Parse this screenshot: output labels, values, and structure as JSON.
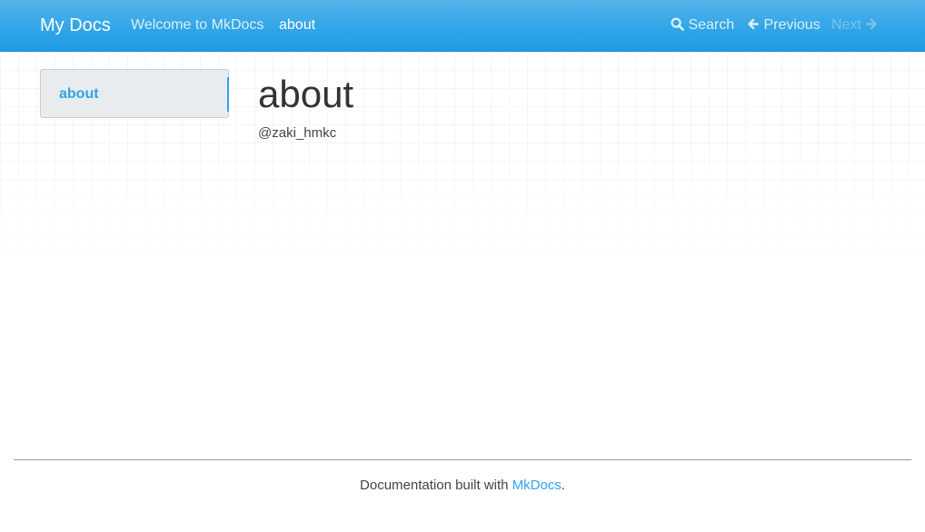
{
  "navbar": {
    "brand": "My Docs",
    "links": [
      "Welcome to MkDocs",
      "about"
    ],
    "search_label": "Search",
    "previous_label": "Previous",
    "next_label": "Next"
  },
  "sidebar": {
    "items": [
      {
        "label": "about"
      }
    ]
  },
  "main": {
    "title": "about",
    "text": "@zaki_hmkc"
  },
  "footer": {
    "prefix": "Documentation built with ",
    "link": "MkDocs",
    "suffix": "."
  },
  "colors": {
    "navbar": "#2fa4e7",
    "link": "#2fa4e7",
    "sidebar_bg": "#e9ecef"
  }
}
